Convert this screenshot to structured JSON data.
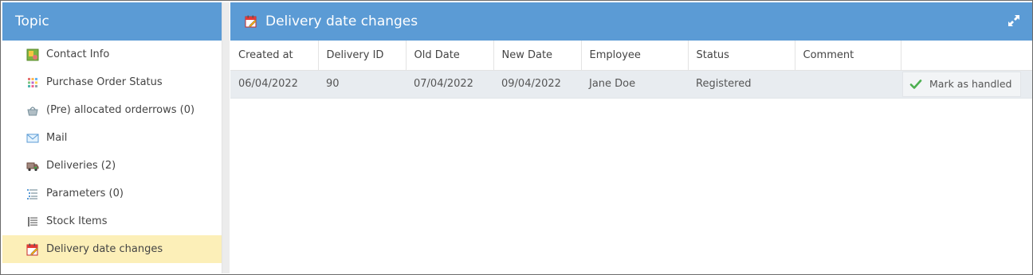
{
  "sidebar": {
    "header": "Topic",
    "items": [
      {
        "label": "Contact Info",
        "icon": "contact-card-icon"
      },
      {
        "label": "Purchase Order Status",
        "icon": "status-grid-icon"
      },
      {
        "label": "(Pre) allocated orderrows (0)",
        "icon": "basket-icon"
      },
      {
        "label": "Mail",
        "icon": "envelope-icon"
      },
      {
        "label": "Deliveries (2)",
        "icon": "truck-icon"
      },
      {
        "label": "Parameters (0)",
        "icon": "parameters-list-icon"
      },
      {
        "label": "Stock Items",
        "icon": "stock-list-icon"
      },
      {
        "label": "Delivery date changes",
        "icon": "calendar-edit-icon",
        "active": true
      }
    ]
  },
  "panel": {
    "title": "Delivery date changes",
    "title_icon": "calendar-edit-icon",
    "expand_icon": "expand-icon"
  },
  "table": {
    "columns": [
      "Created at",
      "Delivery ID",
      "Old Date",
      "New Date",
      "Employee",
      "Status",
      "Comment",
      ""
    ],
    "rows": [
      {
        "created_at": "06/04/2022",
        "delivery_id": "90",
        "old_date": "07/04/2022",
        "new_date": "09/04/2022",
        "employee": "Jane Doe",
        "status": "Registered",
        "comment": "",
        "action_label": "Mark as handled"
      }
    ]
  },
  "colors": {
    "header_blue": "#5b9bd5",
    "active_item": "#fcefb8",
    "row_background": "#e8ecf0",
    "check_green": "#4caf50"
  }
}
